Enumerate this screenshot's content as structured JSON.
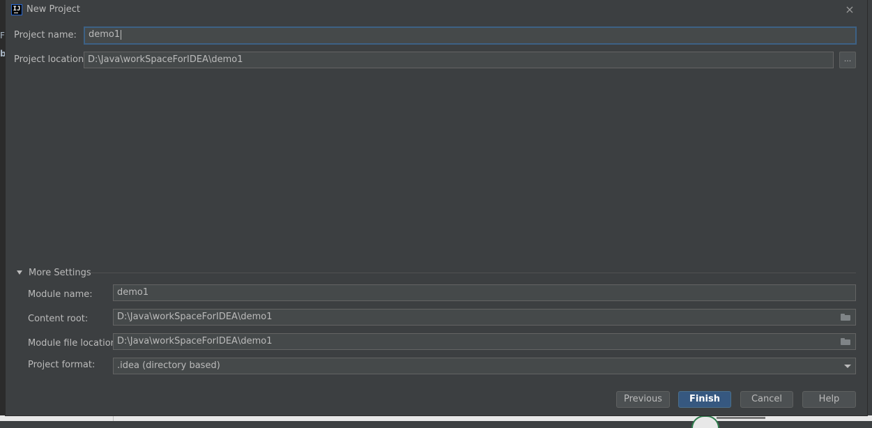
{
  "background": {
    "left_fragment_1": "Fi",
    "left_fragment_2": "b"
  },
  "dialog": {
    "title": "New Project",
    "app_icon_text": "IJ",
    "close_icon": "×"
  },
  "project": {
    "name_label": "Project name:",
    "name_value": "demo1",
    "location_label": "Project location:",
    "location_value": "D:\\Java\\workSpaceForIDEA\\demo1",
    "browse_label": "..."
  },
  "more_settings": {
    "label": "More Settings",
    "expanded": true,
    "module_name_label": "Module name:",
    "module_name_value": "demo1",
    "content_root_label": "Content root:",
    "content_root_value": "D:\\Java\\workSpaceForIDEA\\demo1",
    "module_file_location_label": "Module file location:",
    "module_file_location_value": "D:\\Java\\workSpaceForIDEA\\demo1",
    "project_format_label": "Project format:",
    "project_format_value": ".idea (directory based)"
  },
  "buttons": {
    "previous": "Previous",
    "finish": "Finish",
    "cancel": "Cancel",
    "help": "Help"
  },
  "colors": {
    "dialog_bg": "#3c3f41",
    "field_bg": "#45494a",
    "focus_border": "#3d6185",
    "primary_button": "#365880",
    "text": "#bbbbbb"
  }
}
